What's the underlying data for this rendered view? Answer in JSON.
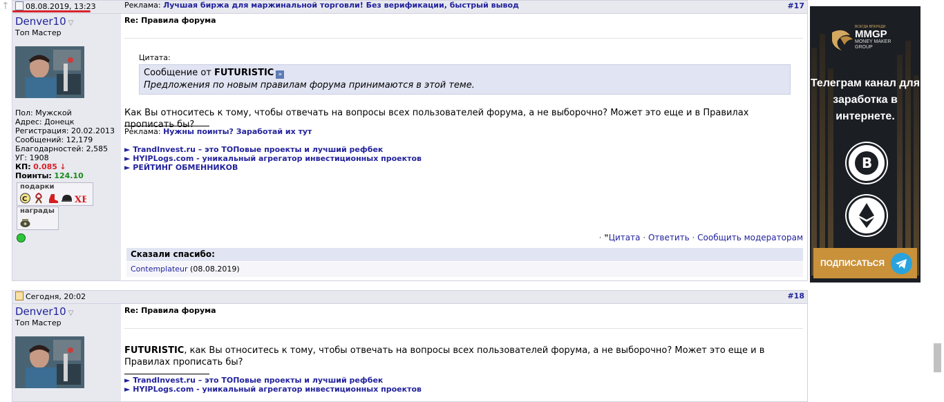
{
  "post1": {
    "date": "08.08.2019, 13:23",
    "ad_prefix": "Реклама:",
    "ad_link": "Лучшая биржа для маржинальной торговли! Без верификации, быстрый вывод",
    "number": "#17",
    "user": {
      "name": "Denver10",
      "rank": "Топ Мастер",
      "gender": "Пол: Мужской",
      "address": "Адрес: Донецк",
      "registered": "Регистрация: 20.02.2013",
      "messages": "Сообщений: 12,179",
      "thanks": "Благодарностей: 2,585",
      "ug": "УГ: 1908",
      "kp_label": "КП:",
      "kp_value": "0.085",
      "kp_arrow": "↓",
      "points_label": "Поинты:",
      "points_value": "124.10",
      "gifts_title": "подарки",
      "awards_title": "награды"
    },
    "title": "Re: Правила форума",
    "quote_label": "Цитата:",
    "quote_from_prefix": "Сообщение от",
    "quote_author": "FUTURISTIC",
    "quote_text": "Предложения по новым правилам форума принимаются в этой теме.",
    "body": "Как Вы относитесь к тому, чтобы отвечать на вопросы всех пользователей форума, а не выборочно? Может это еще и в Правилах прописать бы?",
    "sig_ad_prefix": "Реклама:",
    "sig_ad_link": "Нужны поинты? Заработай их тут",
    "links": [
      "► TrandInvest.ru – это ТОПовые проекты и лучший рефбек",
      "► HYIPLogs.com - уникальный агрегатор инвестиционных проектов",
      "► РЕЙТИНГ ОБМЕННИКОВ"
    ],
    "actions": {
      "quote": "Цитата",
      "reply": "Ответить",
      "report": "Сообщить модераторам"
    },
    "thanks_title": "Сказали спасибо:",
    "thanks_user": "Contemplateur",
    "thanks_date": "(08.08.2019)"
  },
  "post2": {
    "date": "Сегодня, 20:02",
    "number": "#18",
    "user": {
      "name": "Denver10",
      "rank": "Топ Мастер"
    },
    "title": "Re: Правила форума",
    "body_bold": "FUTURISTIC",
    "body": ", как Вы относитесь к тому, чтобы отвечать на вопросы всех пользователей форума, а не выборочно? Может это еще и в Правилах прописать бы?",
    "links": [
      "► TrandInvest.ru – это ТОПовые проекты и лучший рефбек",
      "► HYIPLogs.com - уникальный агрегатор инвестиционных проектов"
    ]
  },
  "banner": {
    "brand_top": "ВСЕГДА ВПЕРЕДИ",
    "brand": "MMGP",
    "brand_sub1": "MONEY MAKER",
    "brand_sub2": "GROUP",
    "text": "Телеграм канал для заработка в интернете.",
    "subscribe": "ПОДПИСАТЬСЯ"
  },
  "colors": {
    "link": "#22229c",
    "header_bg": "#e7e9ef",
    "quote_bg": "#e1e4f2",
    "red": "#d8232a",
    "green": "#1a8b1a",
    "banner_bg": "#1b1e23",
    "subscribe_bg": "#c9913a",
    "telegram": "#2aa3dc"
  }
}
